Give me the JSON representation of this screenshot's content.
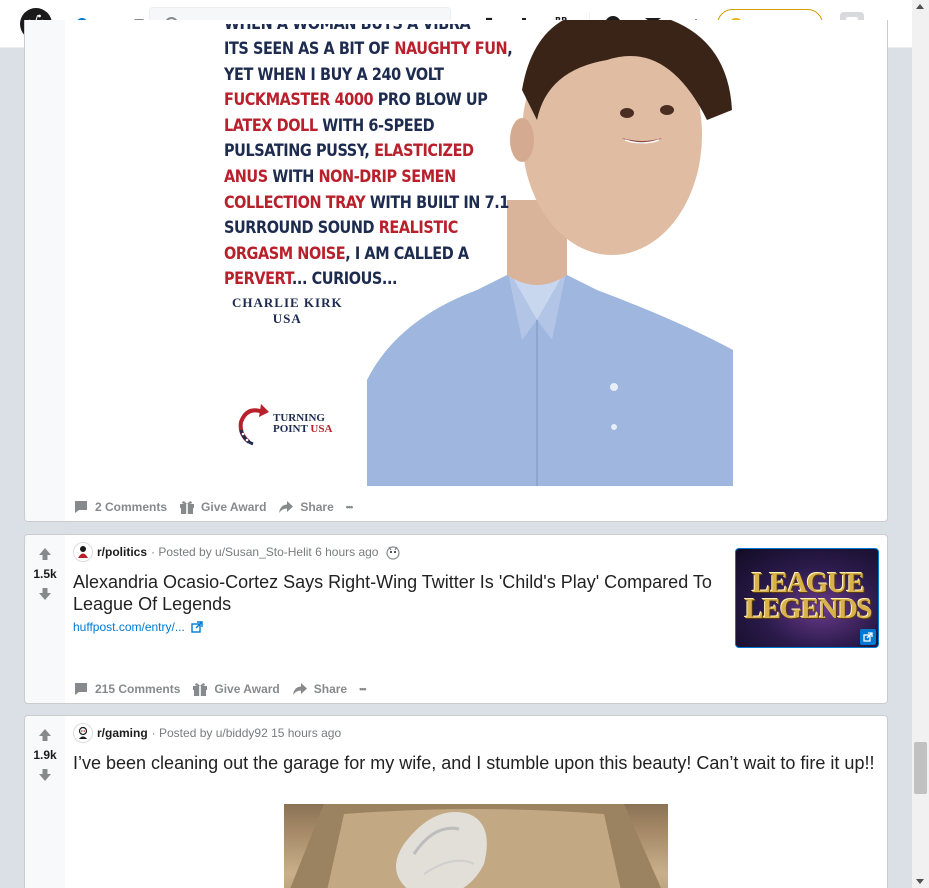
{
  "header": {
    "search_placeholder": "Search",
    "get_coins_label": "Get Coins",
    "coin_symbol": "C"
  },
  "posts": [
    {
      "meme": {
        "lines": [
          [
            {
              "t": "WHEN A WOMAN BUYS A VIBRATOR,",
              "r": false
            }
          ],
          [
            {
              "t": "ITS SEEN AS A BIT OF ",
              "r": false
            },
            {
              "t": "NAUGHTY FUN",
              "r": true
            },
            {
              "t": ",",
              "r": false
            }
          ],
          [
            {
              "t": "YET WHEN I BUY A 240 VOLT",
              "r": false
            }
          ],
          [
            {
              "t": "FUCKMASTER 4000",
              "r": true
            },
            {
              "t": " PRO BLOW UP",
              "r": false
            }
          ],
          [
            {
              "t": "LATEX DOLL",
              "r": true
            },
            {
              "t": " WITH 6-SPEED",
              "r": false
            }
          ],
          [
            {
              "t": "PULSATING PUSSY, ",
              "r": false
            },
            {
              "t": "ELASTICIZED",
              "r": true
            }
          ],
          [
            {
              "t": "ANUS",
              "r": true
            },
            {
              "t": " WITH ",
              "r": false
            },
            {
              "t": "NON-DRIP SEMEN",
              "r": true
            }
          ],
          [
            {
              "t": "COLLECTION TRAY",
              "r": true
            },
            {
              "t": " WITH BUILT IN 7.1",
              "r": false
            }
          ],
          [
            {
              "t": "SURROUND SOUND ",
              "r": false
            },
            {
              "t": "REALISTIC",
              "r": true
            }
          ],
          [
            {
              "t": "ORGASM NOISE",
              "r": true
            },
            {
              "t": ", I AM CALLED A",
              "r": false
            }
          ],
          [
            {
              "t": "PERVERT",
              "r": true
            },
            {
              "t": "... CURIOUS...",
              "r": false
            }
          ]
        ],
        "attribution_name": "CHARLIE KIRK",
        "attribution_country": "USA",
        "logo_line1": "TURNING",
        "logo_line2": "POINT",
        "logo_usa": "USA"
      },
      "actions": {
        "comments": "2 Comments",
        "award": "Give Award",
        "share": "Share",
        "more": "•••"
      }
    },
    {
      "score": "1.5k",
      "subreddit": "r/politics",
      "posted_by": "· Posted by u/Susan_Sto-Helit 6 hours ago",
      "title": "Alexandria Ocasio-Cortez Says Right-Wing Twitter Is 'Child's Play' Compared To League Of Legends",
      "link": "huffpost.com/entry/...",
      "thumbnail_text_1": "LEAGUE",
      "thumbnail_text_2": "LEGENDS",
      "actions": {
        "comments": "215 Comments",
        "award": "Give Award",
        "share": "Share",
        "more": "•••"
      }
    },
    {
      "score": "1.9k",
      "subreddit": "r/gaming",
      "posted_by": "· Posted by u/biddy92 15 hours ago",
      "title": "I’ve been cleaning out the garage for my wife, and I stumble upon this beauty! Can’t wait to fire it up!!"
    }
  ],
  "colors": {
    "accent": "#0079d3",
    "meme_red": "#b8202c",
    "meme_navy": "#1d2b4f",
    "coin_gold": "#e8b417"
  }
}
